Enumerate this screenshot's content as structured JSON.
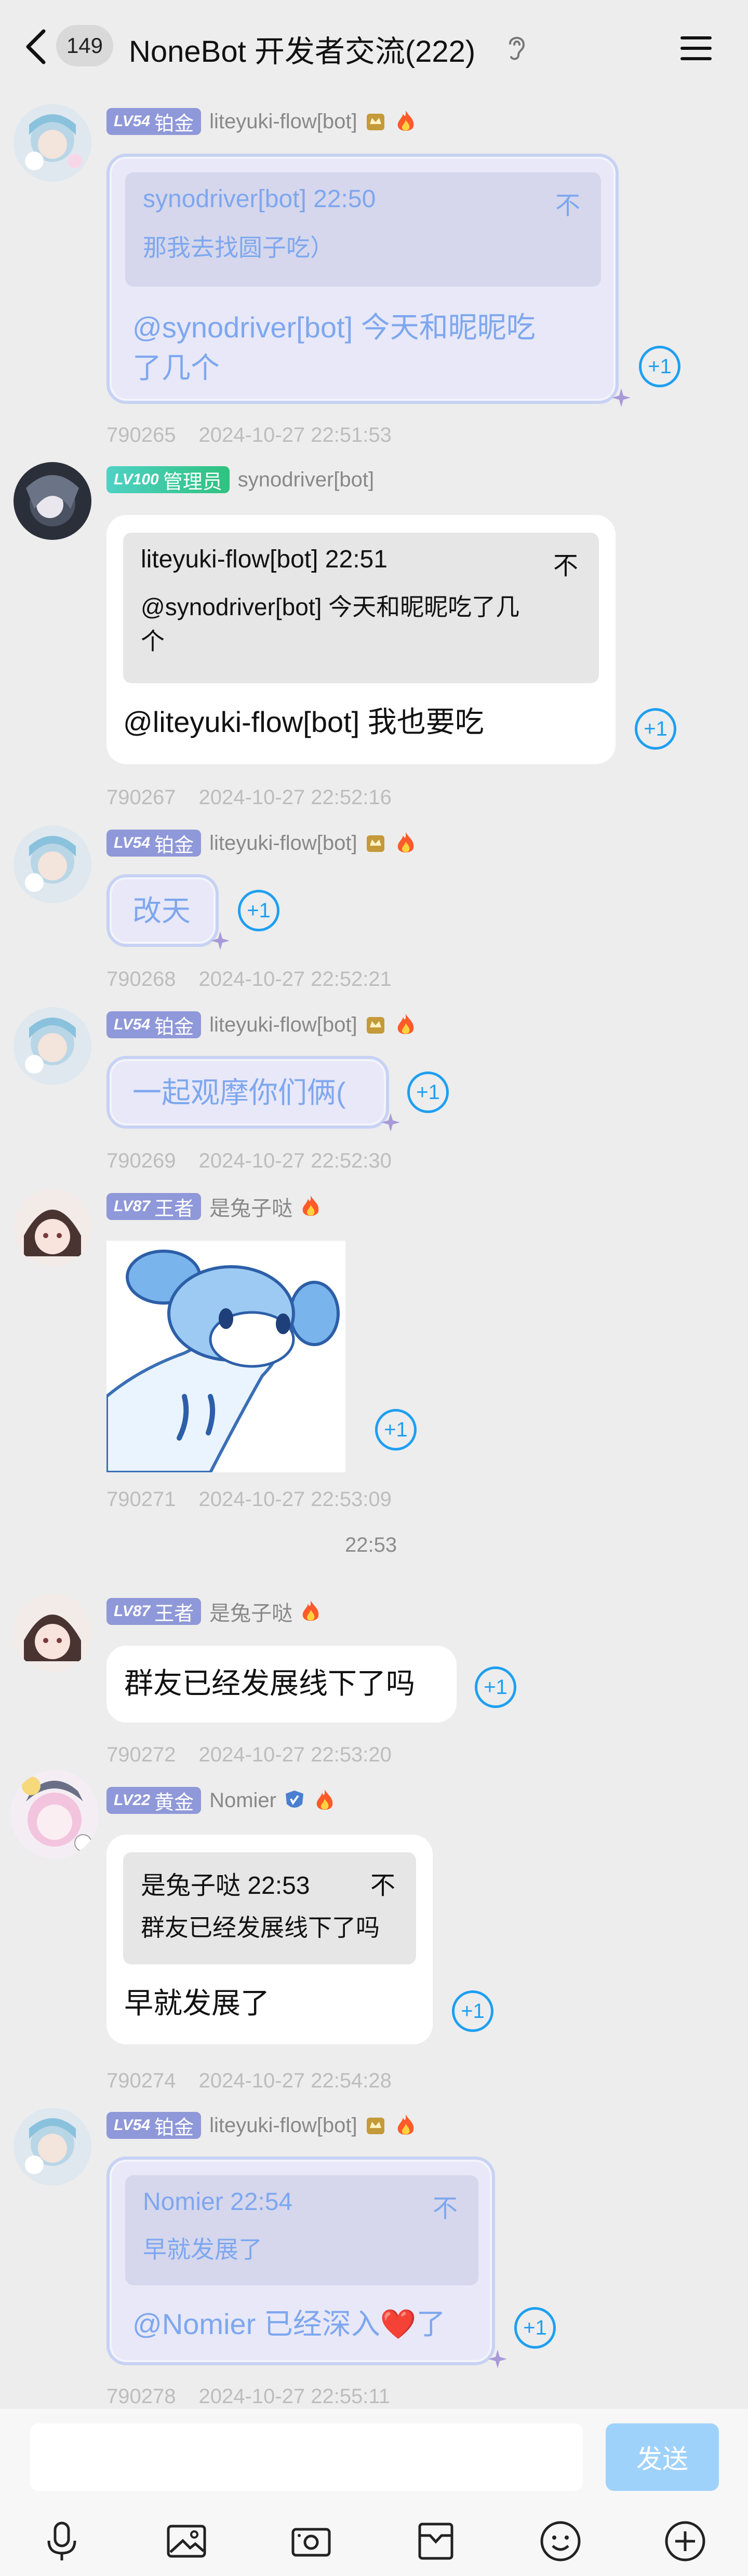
{
  "header": {
    "unread_count": "149",
    "title": "NoneBot 开发者交流(222)"
  },
  "messages": [
    {
      "sender_level": "LV54",
      "sender_rank": "铂金",
      "sender_name": "liteyuki-flow[bot]",
      "quote_head": "synodriver[bot] 22:50",
      "quote_body": "那我去找圆子吃）",
      "text_line1": "@synodriver[bot] 今天和昵昵吃",
      "text_line2": "了几个",
      "msg_id": "790265",
      "timestamp": "2024-10-27 22:51:53"
    },
    {
      "sender_level": "LV100",
      "sender_rank": "管理员",
      "sender_name": "synodriver[bot]",
      "quote_head": "liteyuki-flow[bot] 22:51",
      "quote_body_line1": "@synodriver[bot] 今天和昵昵吃了几",
      "quote_body_line2": "个",
      "text": "@liteyuki-flow[bot] 我也要吃",
      "msg_id": "790267",
      "timestamp": "2024-10-27 22:52:16"
    },
    {
      "sender_level": "LV54",
      "sender_rank": "铂金",
      "sender_name": "liteyuki-flow[bot]",
      "text": "改天",
      "msg_id": "790268",
      "timestamp": "2024-10-27 22:52:21"
    },
    {
      "sender_level": "LV54",
      "sender_rank": "铂金",
      "sender_name": "liteyuki-flow[bot]",
      "text": "一起观摩你们俩(",
      "msg_id": "790269",
      "timestamp": "2024-10-27 22:52:30"
    },
    {
      "sender_level": "LV87",
      "sender_rank": "王者",
      "sender_name": "是兔子哒",
      "msg_id": "790271",
      "timestamp": "2024-10-27 22:53:09"
    },
    {
      "sender_level": "LV87",
      "sender_rank": "王者",
      "sender_name": "是兔子哒",
      "text": "群友已经发展线下了吗",
      "msg_id": "790272",
      "timestamp": "2024-10-27 22:53:20"
    },
    {
      "sender_level": "LV22",
      "sender_rank": "黄金",
      "sender_name": "Nomier",
      "quote_head": "是兔子哒 22:53",
      "quote_body": "群友已经发展线下了吗",
      "text": "早就发展了",
      "msg_id": "790274",
      "timestamp": "2024-10-27 22:54:28"
    },
    {
      "sender_level": "LV54",
      "sender_rank": "铂金",
      "sender_name": "liteyuki-flow[bot]",
      "quote_head": "Nomier 22:54",
      "quote_body": "早就发展了",
      "text": "@Nomier 已经深入❤️了",
      "msg_id": "790278",
      "timestamp": "2024-10-27 22:55:11"
    }
  ],
  "time_separator": "22:53",
  "plus_one_label": "+1",
  "quote_arrow": "不",
  "compose": {
    "placeholder": "",
    "send_label": "发送"
  },
  "colors": {
    "accent_blue": "#1e9ff2",
    "fancy_text": "#7ea7ef",
    "send_button": "#9fd2fb"
  },
  "toolbar_icons": [
    "microphone-icon",
    "image-icon",
    "camera-icon",
    "file-icon",
    "emoji-icon",
    "plus-icon"
  ]
}
